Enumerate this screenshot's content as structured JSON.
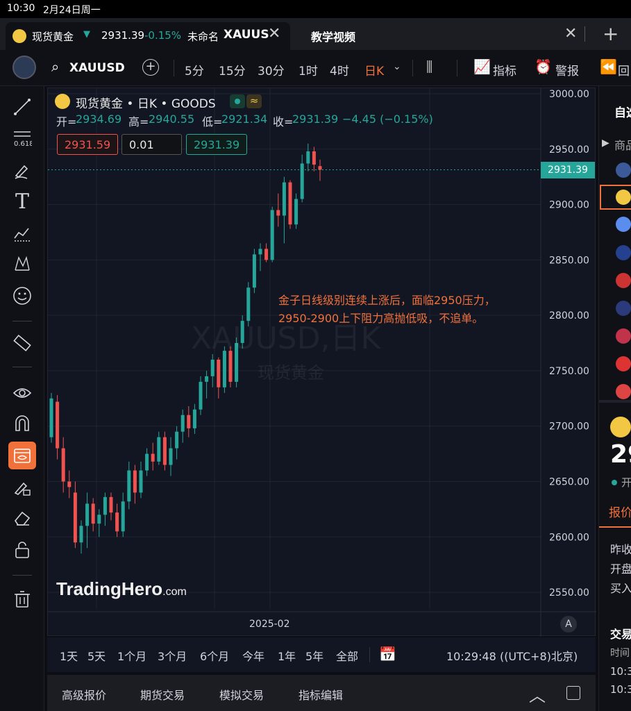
{
  "status_bar": {
    "time": "10:30",
    "date": "2月24日周一"
  },
  "tabs": [
    {
      "name": "现货黄金",
      "price": "2931.39",
      "change": "-0.15%",
      "untitled": "未命名",
      "symbol": "XAUUS"
    },
    {
      "name": "教学视频"
    }
  ],
  "toolbar": {
    "symbol": "XAUUSD",
    "timeframes": [
      "5分",
      "15分",
      "30分",
      "1时",
      "4时",
      "日K"
    ],
    "active_timeframe": "日K",
    "indicators": "指标",
    "alerts": "警报",
    "replay": "回"
  },
  "legend": {
    "title": "现货黄金 • 日K • GOODS",
    "open_label": "开=",
    "open": "2934.69",
    "high_label": "高=",
    "high": "2940.55",
    "low_label": "低=",
    "low": "2921.34",
    "close_label": "收=",
    "close": "2931.39",
    "change": "−4.45 (−0.15%)",
    "sell_price": "2931.59",
    "qty": "0.01",
    "buy_price": "2931.39"
  },
  "watermark": {
    "symbol": "XAUUSD,日K",
    "name": "现货黄金",
    "brand": "TradingHero",
    "brand_suffix": ".com"
  },
  "annotation": {
    "line1": "金子日线级别连续上涨后，面临2950压力，",
    "line2": "2950-2900上下阻力高抛低吸，不追单。"
  },
  "current_price_tag": "2931.39",
  "x_axis_label": "2025-02",
  "auto_scale": "A",
  "range_buttons": [
    "1天",
    "5天",
    "1个月",
    "3个月",
    "6个月",
    "今年",
    "1年",
    "5年",
    "全部"
  ],
  "clock": "10:29:48 ((UTC+8)北京)",
  "bottom_tabs": [
    "高级报价",
    "期货交易",
    "模拟交易",
    "指标编辑"
  ],
  "right_panel": {
    "header": "自选",
    "col": "商品",
    "price_partial": "29",
    "status_partial": "开",
    "tab": "报价",
    "rows": [
      "昨收",
      "开盘",
      "买入"
    ],
    "trades": "交易",
    "time_col": "时间",
    "times": [
      "10:3",
      "10:3"
    ]
  },
  "colors": {
    "up": "#26a69a",
    "down": "#ef5350",
    "accent": "#f0713b",
    "annotation": "#f0713b"
  },
  "chart_data": {
    "type": "candlestick",
    "x_label": "2025-02",
    "ylim": [
      2535,
      3005
    ],
    "y_ticks": [
      3000,
      2950,
      2900,
      2850,
      2800,
      2750,
      2700,
      2650,
      2600,
      2550
    ],
    "candles": [
      {
        "o": 2690,
        "h": 2730,
        "l": 2685,
        "c": 2725
      },
      {
        "o": 2722,
        "h": 2728,
        "l": 2670,
        "c": 2680
      },
      {
        "o": 2680,
        "h": 2690,
        "l": 2640,
        "c": 2650
      },
      {
        "o": 2650,
        "h": 2660,
        "l": 2635,
        "c": 2645
      },
      {
        "o": 2640,
        "h": 2650,
        "l": 2590,
        "c": 2595
      },
      {
        "o": 2595,
        "h": 2615,
        "l": 2585,
        "c": 2610
      },
      {
        "o": 2610,
        "h": 2640,
        "l": 2590,
        "c": 2630
      },
      {
        "o": 2630,
        "h": 2635,
        "l": 2605,
        "c": 2612
      },
      {
        "o": 2612,
        "h": 2625,
        "l": 2600,
        "c": 2620
      },
      {
        "o": 2620,
        "h": 2640,
        "l": 2610,
        "c": 2636
      },
      {
        "o": 2636,
        "h": 2640,
        "l": 2615,
        "c": 2622
      },
      {
        "o": 2622,
        "h": 2630,
        "l": 2600,
        "c": 2605
      },
      {
        "o": 2605,
        "h": 2640,
        "l": 2600,
        "c": 2632
      },
      {
        "o": 2632,
        "h": 2668,
        "l": 2625,
        "c": 2660
      },
      {
        "o": 2660,
        "h": 2665,
        "l": 2630,
        "c": 2640
      },
      {
        "o": 2640,
        "h": 2668,
        "l": 2635,
        "c": 2660
      },
      {
        "o": 2660,
        "h": 2680,
        "l": 2655,
        "c": 2675
      },
      {
        "o": 2675,
        "h": 2685,
        "l": 2660,
        "c": 2668
      },
      {
        "o": 2668,
        "h": 2695,
        "l": 2665,
        "c": 2690
      },
      {
        "o": 2690,
        "h": 2695,
        "l": 2660,
        "c": 2665
      },
      {
        "o": 2665,
        "h": 2690,
        "l": 2655,
        "c": 2680
      },
      {
        "o": 2680,
        "h": 2700,
        "l": 2670,
        "c": 2695
      },
      {
        "o": 2695,
        "h": 2715,
        "l": 2685,
        "c": 2710
      },
      {
        "o": 2710,
        "h": 2718,
        "l": 2690,
        "c": 2698
      },
      {
        "o": 2698,
        "h": 2720,
        "l": 2693,
        "c": 2715
      },
      {
        "o": 2715,
        "h": 2745,
        "l": 2710,
        "c": 2740
      },
      {
        "o": 2740,
        "h": 2750,
        "l": 2725,
        "c": 2745
      },
      {
        "o": 2745,
        "h": 2765,
        "l": 2735,
        "c": 2760
      },
      {
        "o": 2760,
        "h": 2762,
        "l": 2725,
        "c": 2735
      },
      {
        "o": 2735,
        "h": 2772,
        "l": 2730,
        "c": 2768
      },
      {
        "o": 2768,
        "h": 2772,
        "l": 2735,
        "c": 2740
      },
      {
        "o": 2740,
        "h": 2780,
        "l": 2735,
        "c": 2775
      },
      {
        "o": 2775,
        "h": 2800,
        "l": 2770,
        "c": 2795
      },
      {
        "o": 2795,
        "h": 2830,
        "l": 2790,
        "c": 2825
      },
      {
        "o": 2825,
        "h": 2860,
        "l": 2820,
        "c": 2855
      },
      {
        "o": 2855,
        "h": 2865,
        "l": 2840,
        "c": 2860
      },
      {
        "o": 2860,
        "h": 2865,
        "l": 2848,
        "c": 2850
      },
      {
        "o": 2850,
        "h": 2898,
        "l": 2848,
        "c": 2895
      },
      {
        "o": 2895,
        "h": 2910,
        "l": 2880,
        "c": 2890
      },
      {
        "o": 2890,
        "h": 2925,
        "l": 2865,
        "c": 2920
      },
      {
        "o": 2920,
        "h": 2922,
        "l": 2878,
        "c": 2882
      },
      {
        "o": 2882,
        "h": 2910,
        "l": 2878,
        "c": 2905
      },
      {
        "o": 2905,
        "h": 2945,
        "l": 2902,
        "c": 2937
      },
      {
        "o": 2937,
        "h": 2955,
        "l": 2930,
        "c": 2948
      },
      {
        "o": 2948,
        "h": 2952,
        "l": 2930,
        "c": 2936
      },
      {
        "o": 2934.69,
        "h": 2940.55,
        "l": 2921.34,
        "c": 2931.39
      }
    ]
  }
}
